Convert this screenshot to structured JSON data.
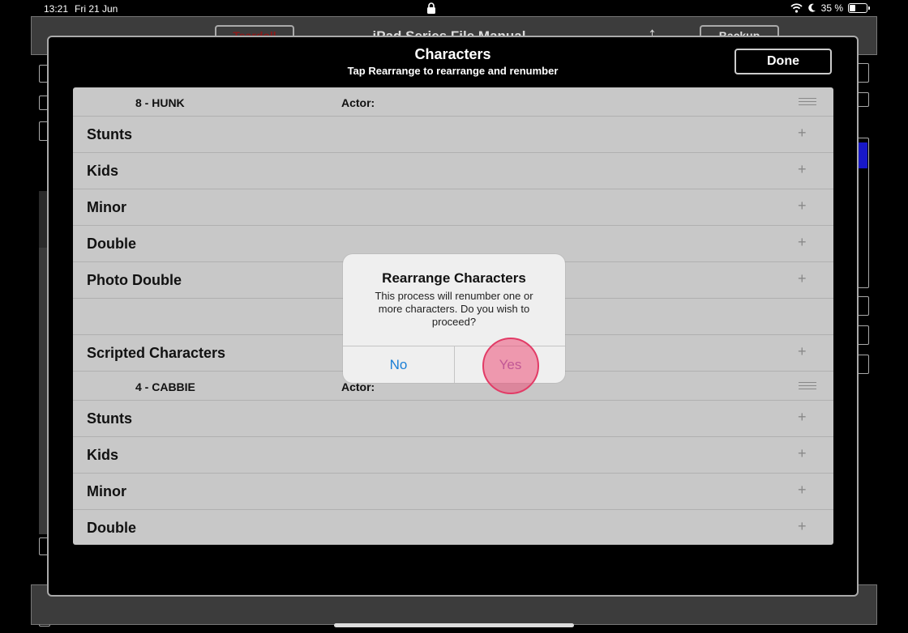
{
  "status_bar": {
    "time": "13:21",
    "date": "Fri 21 Jun",
    "battery": "35 %",
    "battery_level": 0.35
  },
  "background": {
    "left_button": "Teardoll",
    "title": "iPad Series File Manual",
    "right_button": "Backup"
  },
  "sheet": {
    "title": "Characters",
    "subtitle": "Tap Rearrange to rearrange and renumber",
    "done_label": "Done"
  },
  "list": {
    "actor_label": "Actor:",
    "rows": [
      {
        "type": "char",
        "name": "8 - HUNK"
      },
      {
        "type": "group",
        "label": "Stunts"
      },
      {
        "type": "group",
        "label": "Kids"
      },
      {
        "type": "group",
        "label": "Minor"
      },
      {
        "type": "group",
        "label": "Double"
      },
      {
        "type": "group",
        "label": "Photo Double"
      },
      {
        "type": "group",
        "label": ""
      },
      {
        "type": "group",
        "label": "Scripted Characters"
      },
      {
        "type": "char",
        "name": "4 - CABBIE"
      },
      {
        "type": "group",
        "label": "Stunts"
      },
      {
        "type": "group",
        "label": "Kids"
      },
      {
        "type": "group",
        "label": "Minor"
      },
      {
        "type": "group",
        "label": "Double"
      }
    ]
  },
  "alert": {
    "title": "Rearrange Characters",
    "message": "This process will renumber one or more characters. Do you wish to proceed?",
    "no_label": "No",
    "yes_label": "Yes"
  }
}
